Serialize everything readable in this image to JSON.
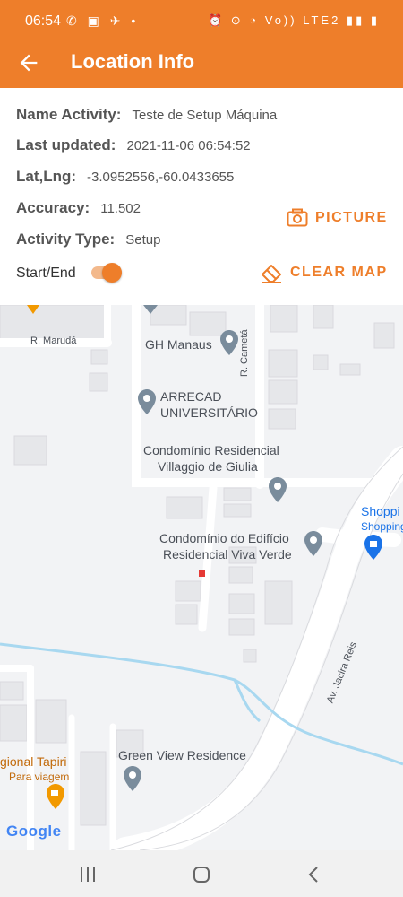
{
  "status": {
    "time": "06:54",
    "left_icons": "✆ ▣ ✈ •",
    "right_icons": "⏰ ⊙ ◔ Vo)) LTE2 ▮▮ ▮"
  },
  "header": {
    "title": "Location Info"
  },
  "info": {
    "name_label": "Name Activity:",
    "name_value": "Teste de Setup Máquina",
    "updated_label": "Last updated:",
    "updated_value": "2021-11-06 06:54:52",
    "latlng_label": "Lat,Lng:",
    "latlng_value": "-3.0952556,-60.0433655",
    "accuracy_label": "Accuracy:",
    "accuracy_value": "11.502",
    "type_label": "Activity Type:",
    "type_value": "Setup",
    "startend_label": "Start/End",
    "startend_on": true
  },
  "actions": {
    "picture": "PICTURE",
    "clear_map": "CLEAR MAP"
  },
  "map": {
    "street_maruda": "R. Marudá",
    "street_cameta": "R. Cametá",
    "street_jacira": "Av. Jacira Reis",
    "poi_gh": "GH Manaus",
    "poi_arrecad_1": "ARRECAD",
    "poi_arrecad_2": "UNIVERSITÁRIO",
    "poi_villaggio_1": "Condomínio Residencial",
    "poi_villaggio_2": "Villaggio de Giulia",
    "poi_viva_1": "Condomínio do Edifício",
    "poi_viva_2": "Residencial Viva Verde",
    "poi_shopping_1": "Shoppi",
    "poi_shopping_2": "Shopping",
    "poi_green": "Green View Residence",
    "poi_tapiri_1": "gional Tapiri",
    "poi_tapiri_2": "Para viagem",
    "logo": "Google"
  },
  "colors": {
    "accent": "#ee7e2a",
    "marker": "#e53935",
    "water": "#a8d8f0"
  }
}
